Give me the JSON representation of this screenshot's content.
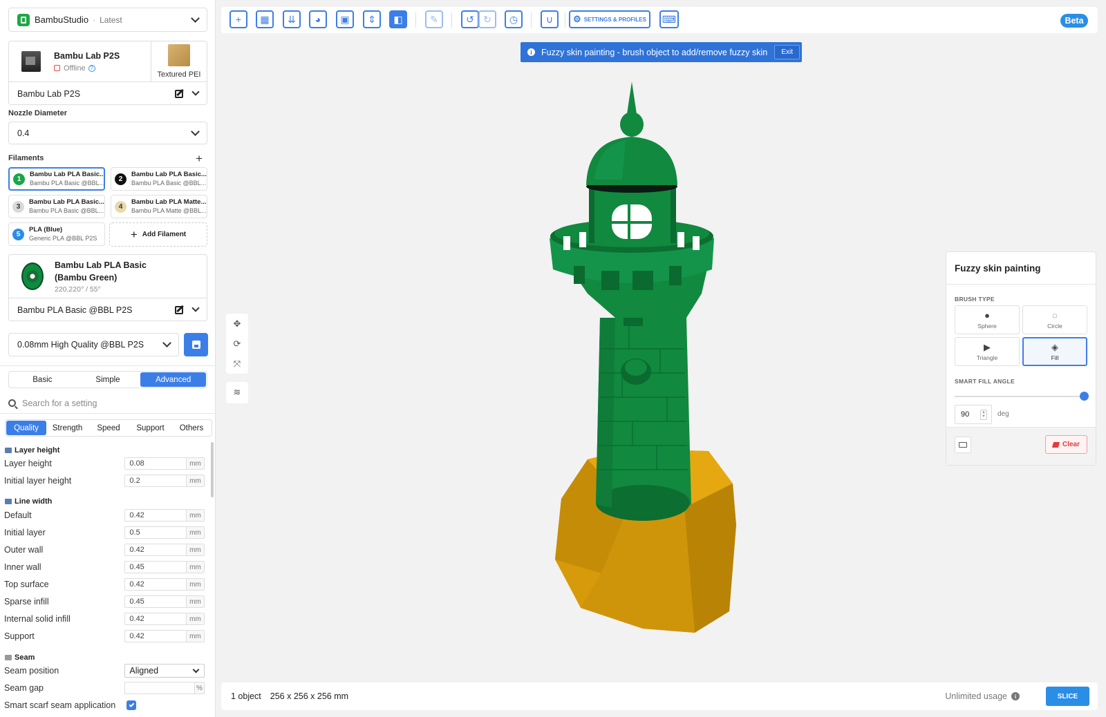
{
  "app": {
    "name": "BambuStudio",
    "separator": "·",
    "version": "Latest"
  },
  "printer": {
    "name": "Bambu Lab P2S",
    "status": "Offline",
    "plate": "Textured PEI",
    "preset": "Bambu Lab P2S"
  },
  "nozzle": {
    "label": "Nozzle Diameter",
    "value": "0.4"
  },
  "filaments": {
    "label": "Filaments",
    "add_label": "Add Filament",
    "items": [
      {
        "num": "1",
        "title": "Bambu Lab PLA Basic...",
        "subtitle": "Bambu PLA Basic @BBL...",
        "color": "#1aa64a",
        "text_color": "#ffffff"
      },
      {
        "num": "2",
        "title": "Bambu Lab PLA Basic...",
        "subtitle": "Bambu PLA Basic @BBL...",
        "color": "#111111",
        "text_color": "#ffffff"
      },
      {
        "num": "3",
        "title": "Bambu Lab PLA Basic...",
        "subtitle": "Bambu PLA Basic @BBL...",
        "color": "#d9d9d9",
        "text_color": "#333333"
      },
      {
        "num": "4",
        "title": "Bambu Lab PLA Matte...",
        "subtitle": "Bambu PLA Matte @BBL...",
        "color": "#e8d9ad",
        "text_color": "#333333"
      },
      {
        "num": "5",
        "title": "PLA (Blue)",
        "subtitle": "Generic PLA @BBL P2S",
        "color": "#2a8ee6",
        "text_color": "#ffffff"
      }
    ]
  },
  "selected_filament": {
    "title": "Bambu Lab PLA Basic (Bambu Green)",
    "temps": "220,220° / 55°",
    "preset": "Bambu PLA Basic @BBL P2S"
  },
  "process": {
    "preset": "0.08mm High Quality @BBL P2S"
  },
  "modes": [
    "Basic",
    "Simple",
    "Advanced"
  ],
  "active_mode": "Advanced",
  "search": {
    "placeholder": "Search for a setting"
  },
  "tabs": [
    "Quality",
    "Strength",
    "Speed",
    "Support",
    "Others"
  ],
  "active_tab": "Quality",
  "settings": {
    "layer_height": {
      "title": "Layer height",
      "rows": [
        {
          "label": "Layer height",
          "value": "0.08",
          "unit": "mm"
        },
        {
          "label": "Initial layer height",
          "value": "0.2",
          "unit": "mm"
        }
      ]
    },
    "line_width": {
      "title": "Line width",
      "rows": [
        {
          "label": "Default",
          "value": "0.42",
          "unit": "mm"
        },
        {
          "label": "Initial layer",
          "value": "0.5",
          "unit": "mm"
        },
        {
          "label": "Outer wall",
          "value": "0.42",
          "unit": "mm"
        },
        {
          "label": "Inner wall",
          "value": "0.45",
          "unit": "mm"
        },
        {
          "label": "Top surface",
          "value": "0.42",
          "unit": "mm"
        },
        {
          "label": "Sparse infill",
          "value": "0.45",
          "unit": "mm"
        },
        {
          "label": "Internal solid infill",
          "value": "0.42",
          "unit": "mm"
        },
        {
          "label": "Support",
          "value": "0.42",
          "unit": "mm"
        }
      ]
    },
    "seam": {
      "title": "Seam",
      "position_label": "Seam position",
      "position_value": "Aligned",
      "gap_label": "Seam gap",
      "gap_value": "",
      "gap_unit": "%",
      "scarf_label": "Smart scarf seam application",
      "scarf_checked": true
    }
  },
  "toolbar": {
    "settings_label": "SETTINGS & PROFILES",
    "beta_label": "Beta"
  },
  "banner": {
    "text": "Fuzzy skin painting - brush object to add/remove fuzzy skin",
    "exit_label": "Exit"
  },
  "fuzzy_panel": {
    "title": "Fuzzy skin painting",
    "brush_type_label": "BRUSH TYPE",
    "brushes": [
      "Sphere",
      "Circle",
      "Triangle",
      "Fill"
    ],
    "active_brush": "Fill",
    "smart_fill_label": "SMART FILL ANGLE",
    "angle_value": "90",
    "angle_unit": "deg",
    "angle_fraction": 1.0,
    "clear_label": "Clear"
  },
  "status": {
    "objects": "1 object",
    "dimensions": "256 x 256 x 256 mm",
    "usage": "Unlimited usage",
    "slice_label": "SLICE"
  },
  "colors": {
    "accent": "#3b7ee8",
    "model_green": "#11893f",
    "model_base": "#d69a0a",
    "danger": "#e23b3b"
  }
}
